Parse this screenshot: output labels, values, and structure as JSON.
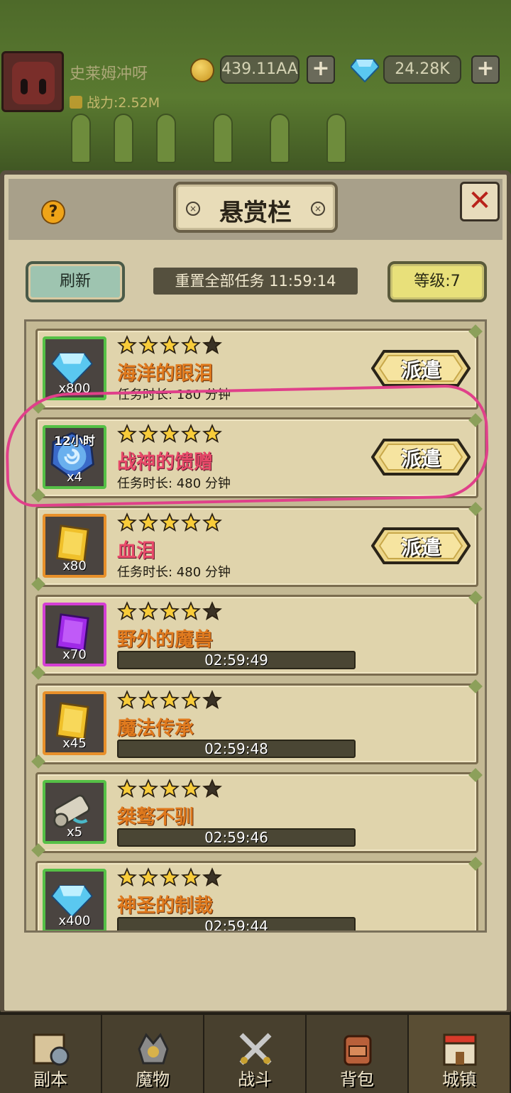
{
  "player": {
    "name": "史莱姆冲呀",
    "power": "战力:2.52M"
  },
  "resources": {
    "gold": "439.11AA",
    "gems": "24.28K",
    "plus": "+"
  },
  "panel": {
    "title": "悬赏栏",
    "help": "?",
    "close": "✕",
    "refresh_label": "刷新",
    "reset_text": "重置全部任务 11:59:14",
    "level_label": "等级:7"
  },
  "tasks": [
    {
      "stars": 4,
      "name": "海洋的眼泪",
      "qty": "x800",
      "duration": "任务时长: 180 分钟",
      "action": "派遣",
      "item": "diamond-icon",
      "rarity": "green"
    },
    {
      "stars": 5,
      "name": "战神的馈赠",
      "qty": "x4",
      "badge": "12小时",
      "duration": "任务时长: 480 分钟",
      "action": "派遣",
      "item": "time-scroll-icon",
      "rarity": "green"
    },
    {
      "stars": 5,
      "name": "血泪",
      "qty": "x80",
      "duration": "任务时长: 480 分钟",
      "action": "派遣",
      "item": "gold-ticket-icon",
      "rarity": "orange"
    },
    {
      "stars": 4,
      "name": "野外的魔兽",
      "qty": "x70",
      "timer": "02:59:49",
      "item": "purple-ticket-icon",
      "rarity": "magenta"
    },
    {
      "stars": 4,
      "name": "魔法传承",
      "qty": "x45",
      "timer": "02:59:48",
      "item": "gold-ticket-icon",
      "rarity": "orange"
    },
    {
      "stars": 4,
      "name": "桀骜不驯",
      "qty": "x5",
      "timer": "02:59:46",
      "item": "scroll-icon",
      "rarity": "green"
    },
    {
      "stars": 4,
      "name": "神圣的制裁",
      "qty": "x400",
      "timer": "02:59:44",
      "item": "diamond-icon",
      "rarity": "green"
    }
  ],
  "nav": [
    {
      "label": "副本",
      "icon": "map-icon"
    },
    {
      "label": "魔物",
      "icon": "monster-icon"
    },
    {
      "label": "战斗",
      "icon": "crossed-swords-icon"
    },
    {
      "label": "背包",
      "icon": "backpack-icon"
    },
    {
      "label": "城镇",
      "icon": "town-icon"
    }
  ],
  "colors": {
    "highlight": "#e0408a",
    "task_name_orange": "#e07a1e",
    "task_name_pink": "#e84a6a"
  }
}
